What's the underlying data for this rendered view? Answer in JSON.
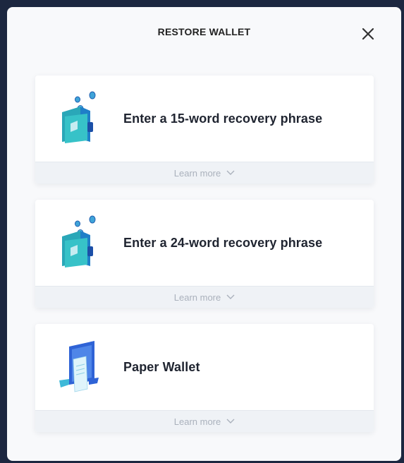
{
  "modal": {
    "title": "RESTORE WALLET",
    "close_icon": "close-icon"
  },
  "options": [
    {
      "title": "Enter a 15-word recovery phrase",
      "learn_more": "Learn more",
      "icon": "wallet-coins-icon"
    },
    {
      "title": "Enter a 24-word recovery phrase",
      "learn_more": "Learn more",
      "icon": "wallet-coins-icon"
    },
    {
      "title": "Paper Wallet",
      "learn_more": "Learn more",
      "icon": "paper-wallet-icon"
    }
  ],
  "colors": {
    "backdrop": "#1c2740",
    "modal": "#f8f9fb",
    "accent_teal": "#2bc1c9",
    "accent_blue": "#2f63d6"
  }
}
